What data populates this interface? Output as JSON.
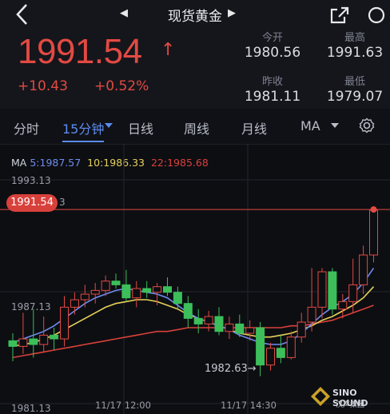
{
  "header": {
    "title": "现货黄金",
    "prev_glyph": "◀",
    "next_glyph": "▶"
  },
  "quote": {
    "price": "1991.54",
    "arrow": "↑",
    "change": "+10.43",
    "change_pct": "+0.52%",
    "stats": [
      {
        "label": "今开",
        "value": "1980.56"
      },
      {
        "label": "最高",
        "value": "1991.63"
      },
      {
        "label": "昨收",
        "value": "1981.11"
      },
      {
        "label": "最低",
        "value": "1979.07"
      }
    ]
  },
  "tabs": [
    {
      "label": "分时"
    },
    {
      "label": "15分钟"
    },
    {
      "label": "日线"
    },
    {
      "label": "周线"
    },
    {
      "label": "月线"
    },
    {
      "label": "MA"
    }
  ],
  "ma_legend": {
    "ma": "MA",
    "ma5": "5:1987.57",
    "ma10": "10:1986.33",
    "ma22": "22:1985.68"
  },
  "axis": {
    "top": "1993.13",
    "mid": "1987.13",
    "bottom": "1981.13",
    "current_tag": "1991.54",
    "current_tag_suffix": "3",
    "low_marker": "1982.63→"
  },
  "time_axis": [
    "11/17 12:00",
    "11/17 14:30"
  ],
  "logo": {
    "line1": "SINO SOUND",
    "line2": "汉声集团"
  },
  "colors": {
    "up": "#e24a43",
    "down": "#3cbf5a",
    "accent": "#5b8cf0",
    "ma5": "#6e8cf0",
    "ma10": "#e6d25a",
    "ma22": "#d8413b"
  },
  "chart_data": {
    "type": "candlestick",
    "ylim": [
      1981.13,
      1993.13
    ],
    "current_price": 1991.54,
    "candles": [
      {
        "o": 1984.5,
        "h": 1984.9,
        "l": 1983.4,
        "c": 1984.2
      },
      {
        "o": 1984.2,
        "h": 1986.0,
        "l": 1983.8,
        "c": 1984.6
      },
      {
        "o": 1984.6,
        "h": 1986.2,
        "l": 1983.6,
        "c": 1984.3
      },
      {
        "o": 1984.3,
        "h": 1985.8,
        "l": 1983.9,
        "c": 1984.8
      },
      {
        "o": 1984.8,
        "h": 1985.2,
        "l": 1984.0,
        "c": 1984.6
      },
      {
        "o": 1984.6,
        "h": 1986.9,
        "l": 1984.2,
        "c": 1986.3
      },
      {
        "o": 1986.3,
        "h": 1987.1,
        "l": 1985.9,
        "c": 1986.7
      },
      {
        "o": 1986.7,
        "h": 1987.5,
        "l": 1986.3,
        "c": 1987.0
      },
      {
        "o": 1987.0,
        "h": 1987.6,
        "l": 1986.5,
        "c": 1987.2
      },
      {
        "o": 1987.2,
        "h": 1988.0,
        "l": 1986.9,
        "c": 1987.7
      },
      {
        "o": 1987.7,
        "h": 1988.1,
        "l": 1987.3,
        "c": 1987.5
      },
      {
        "o": 1987.5,
        "h": 1988.3,
        "l": 1986.6,
        "c": 1986.8
      },
      {
        "o": 1986.8,
        "h": 1987.7,
        "l": 1986.3,
        "c": 1987.3
      },
      {
        "o": 1987.3,
        "h": 1987.7,
        "l": 1986.8,
        "c": 1987.1
      },
      {
        "o": 1987.1,
        "h": 1987.6,
        "l": 1986.4,
        "c": 1987.4
      },
      {
        "o": 1987.4,
        "h": 1987.9,
        "l": 1986.9,
        "c": 1987.1
      },
      {
        "o": 1987.1,
        "h": 1987.4,
        "l": 1986.2,
        "c": 1986.5
      },
      {
        "o": 1986.5,
        "h": 1986.9,
        "l": 1985.2,
        "c": 1985.7
      },
      {
        "o": 1985.7,
        "h": 1986.2,
        "l": 1984.9,
        "c": 1985.4
      },
      {
        "o": 1985.4,
        "h": 1986.1,
        "l": 1985.0,
        "c": 1985.8
      },
      {
        "o": 1985.8,
        "h": 1986.3,
        "l": 1984.8,
        "c": 1985.0
      },
      {
        "o": 1985.0,
        "h": 1985.8,
        "l": 1984.6,
        "c": 1985.4
      },
      {
        "o": 1985.4,
        "h": 1985.9,
        "l": 1984.7,
        "c": 1984.9
      },
      {
        "o": 1984.9,
        "h": 1985.6,
        "l": 1984.5,
        "c": 1985.2
      },
      {
        "o": 1985.2,
        "h": 1985.5,
        "l": 1982.6,
        "c": 1983.2
      },
      {
        "o": 1983.2,
        "h": 1984.4,
        "l": 1982.9,
        "c": 1984.1
      },
      {
        "o": 1984.1,
        "h": 1984.8,
        "l": 1983.3,
        "c": 1983.6
      },
      {
        "o": 1983.6,
        "h": 1985.0,
        "l": 1983.5,
        "c": 1984.7
      },
      {
        "o": 1984.7,
        "h": 1986.0,
        "l": 1984.4,
        "c": 1985.5
      },
      {
        "o": 1985.5,
        "h": 1988.4,
        "l": 1985.0,
        "c": 1986.3
      },
      {
        "o": 1986.3,
        "h": 1988.4,
        "l": 1985.7,
        "c": 1988.2
      },
      {
        "o": 1988.2,
        "h": 1988.4,
        "l": 1985.9,
        "c": 1986.2
      },
      {
        "o": 1986.2,
        "h": 1987.0,
        "l": 1985.7,
        "c": 1986.6
      },
      {
        "o": 1986.6,
        "h": 1988.9,
        "l": 1986.0,
        "c": 1987.5
      },
      {
        "o": 1987.5,
        "h": 1989.6,
        "l": 1987.0,
        "c": 1989.1
      },
      {
        "o": 1989.1,
        "h": 1991.6,
        "l": 1988.7,
        "c": 1991.5
      }
    ],
    "ma5": [
      1984.4,
      1984.6,
      1984.8,
      1985.0,
      1985.3,
      1985.7,
      1986.1,
      1986.5,
      1986.8,
      1987.0,
      1987.2,
      1987.3,
      1987.2,
      1987.1,
      1987.0,
      1986.8,
      1986.4,
      1986.0,
      1985.7,
      1985.5,
      1985.3,
      1985.1,
      1984.8,
      1984.6,
      1984.4,
      1984.3,
      1984.3,
      1984.5,
      1984.9,
      1985.4,
      1985.9,
      1986.3,
      1986.6,
      1987.0,
      1987.6,
      1988.4
    ],
    "ma10": [
      1984.2,
      1984.3,
      1984.4,
      1984.6,
      1984.8,
      1985.1,
      1985.4,
      1985.7,
      1986.0,
      1986.3,
      1986.5,
      1986.6,
      1986.7,
      1986.7,
      1986.6,
      1986.4,
      1986.2,
      1985.9,
      1985.7,
      1985.5,
      1985.3,
      1985.1,
      1984.9,
      1984.8,
      1984.7,
      1984.7,
      1984.8,
      1984.9,
      1985.1,
      1985.3,
      1985.6,
      1985.8,
      1986.1,
      1986.4,
      1986.8,
      1987.4
    ],
    "ma22": [
      1983.6,
      1983.7,
      1983.8,
      1983.9,
      1984.0,
      1984.1,
      1984.2,
      1984.3,
      1984.4,
      1984.5,
      1984.6,
      1984.7,
      1984.8,
      1984.9,
      1985.0,
      1985.0,
      1985.1,
      1985.2,
      1985.2,
      1985.2,
      1985.2,
      1985.2,
      1985.2,
      1985.2,
      1985.2,
      1985.2,
      1985.2,
      1985.3,
      1985.3,
      1985.4,
      1985.5,
      1985.6,
      1985.8,
      1986.0,
      1986.2,
      1986.4
    ]
  }
}
